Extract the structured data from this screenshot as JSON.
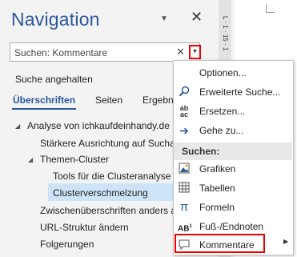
{
  "pane": {
    "title": "Navigation",
    "caret_icon": "caret-down-icon",
    "close_icon": "close-icon"
  },
  "search": {
    "value": "Suchen: Kommentare",
    "clear_icon": "close-icon",
    "dropdown_icon": "caret-down-icon"
  },
  "status": "Suche angehalten",
  "tabs": [
    {
      "label": "Überschriften",
      "active": true
    },
    {
      "label": "Seiten",
      "active": false
    },
    {
      "label": "Ergebn",
      "active": false
    }
  ],
  "tree": [
    {
      "label": "Analyse von ichkaufdeinhandy.de",
      "expanded": true
    },
    {
      "label": "Stärkere Ausrichtung auf Sucha"
    },
    {
      "label": "Themen-Cluster",
      "expanded": true
    },
    {
      "label": "Tools für die Clusteranalyse"
    },
    {
      "label": "Clusterverschmelzung",
      "selected": true
    },
    {
      "label": "Zwischenüberschriften anders a"
    },
    {
      "label": "URL-Struktur ändern"
    },
    {
      "label": "Folgerungen"
    }
  ],
  "ruler": {
    "marks": "L · 1 · 15 · 1"
  },
  "menu": {
    "items": [
      {
        "label": "Optionen...",
        "icon": "none"
      },
      {
        "label": "Erweiterte Suche...",
        "icon": "search-icon"
      },
      {
        "label": "Ersetzen...",
        "icon": "replace-icon"
      },
      {
        "label": "Gehe zu...",
        "icon": "arrow-right-icon"
      }
    ],
    "section_label": "Suchen:",
    "search_items": [
      {
        "label": "Grafiken",
        "icon": "image-icon"
      },
      {
        "label": "Tabellen",
        "icon": "table-icon"
      },
      {
        "label": "Formeln",
        "icon": "pi-icon"
      },
      {
        "label": "Fuß-/Endnoten",
        "icon": "footnote-icon"
      },
      {
        "label": "Kommentare",
        "icon": "comment-icon",
        "has_submenu": true
      }
    ]
  },
  "colors": {
    "accent": "#2b579a",
    "highlight_red": "#ee0000",
    "selection": "#cce4f7"
  }
}
